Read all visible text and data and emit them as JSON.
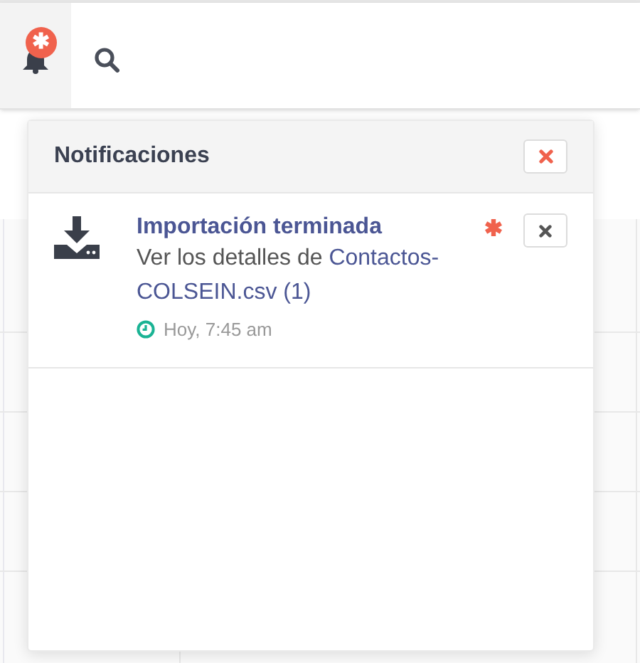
{
  "topbar": {
    "notifications_badge": "✱"
  },
  "panel": {
    "title": "Notificaciones",
    "notifications": [
      {
        "title": "Importación terminada",
        "message": "Ver los detalles de ",
        "link": "Contactos-COLSEIN.csv (1)",
        "time": "Hoy, 7:45 am",
        "unread": true
      }
    ]
  }
}
